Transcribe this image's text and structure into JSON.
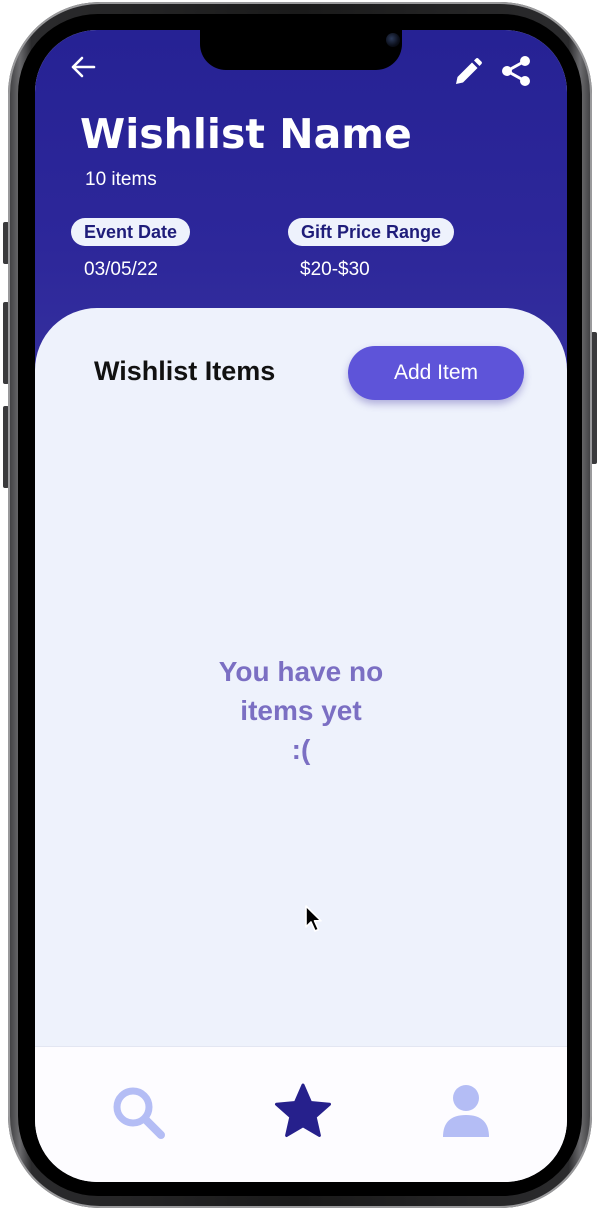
{
  "header": {
    "title": "Wishlist Name",
    "item_count": "10 items",
    "back_icon": "arrow-left-icon",
    "edit_icon": "pencil-icon",
    "share_icon": "share-icon"
  },
  "details": {
    "event_date_label": "Event Date",
    "event_date_value": "03/05/22",
    "price_range_label": "Gift Price Range",
    "price_range_value": "$20-$30"
  },
  "items_section": {
    "title": "Wishlist Items",
    "add_button_label": "Add Item",
    "empty_lines": [
      "You have no",
      "items yet",
      ":("
    ]
  },
  "bottom_nav": {
    "items": [
      {
        "name": "search",
        "icon": "search-icon",
        "active": false
      },
      {
        "name": "wishlists",
        "icon": "star-icon",
        "active": true
      },
      {
        "name": "profile",
        "icon": "user-icon",
        "active": false
      }
    ]
  },
  "colors": {
    "header_bg": "#2a2597",
    "accent_button": "#5e54d9",
    "content_bg": "#eef2fc",
    "empty_text": "#7b6fc3",
    "nav_active": "#26208c",
    "nav_inactive": "#b4bdf5"
  }
}
